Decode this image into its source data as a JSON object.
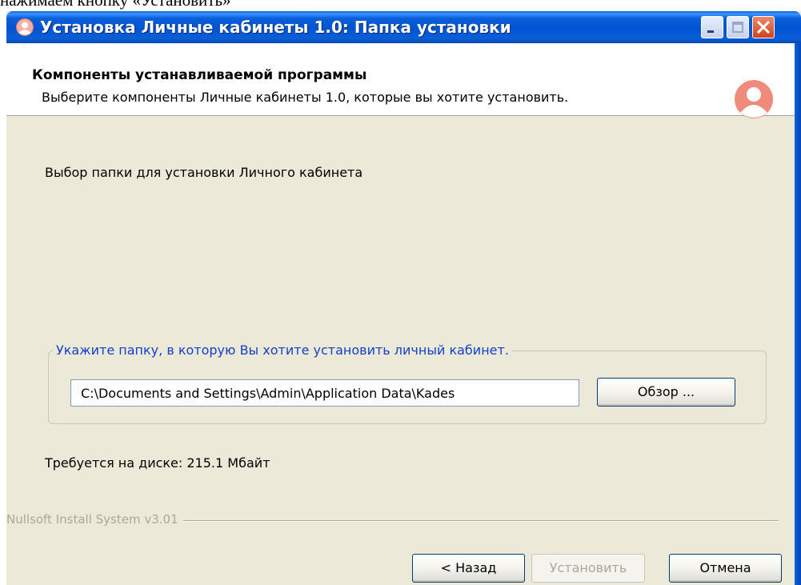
{
  "document": {
    "caption": "нажимаем кнопку «Установить»"
  },
  "window": {
    "title": "Установка Личные кабинеты 1.0: Папка установки",
    "controls": [
      "minimize",
      "maximize",
      "close"
    ]
  },
  "header": {
    "title": "Компоненты устанавливаемой программы",
    "subtitle": "Выберите компоненты Личные кабинеты 1.0, которые вы хотите установить."
  },
  "body": {
    "intro": "Выбор папки для установки Личного кабинета",
    "group_legend": "Укажите папку, в которую Вы хотите установить личный кабинет.",
    "install_path": "C:\\Documents and Settings\\Admin\\Application Data\\Kades",
    "browse_label": "Обзор ...",
    "space_required": "Требуется на диске: 215.1 Мбайт"
  },
  "footer": {
    "branding": "Nullsoft Install System v3.01",
    "back_label": "< Назад",
    "install_label": "Установить",
    "cancel_label": "Отмена"
  },
  "colors": {
    "titlebar": "#0a5fd8",
    "dialog_bg": "#ece9d8",
    "legend_text": "#1240c8",
    "avatar_accent": "#f08a7a",
    "disabled_text": "#aca899"
  },
  "icons": {
    "app": "user-avatar-icon",
    "header": "user-avatar-icon",
    "minimize": "minimize-icon",
    "maximize": "maximize-icon",
    "close": "close-icon"
  }
}
